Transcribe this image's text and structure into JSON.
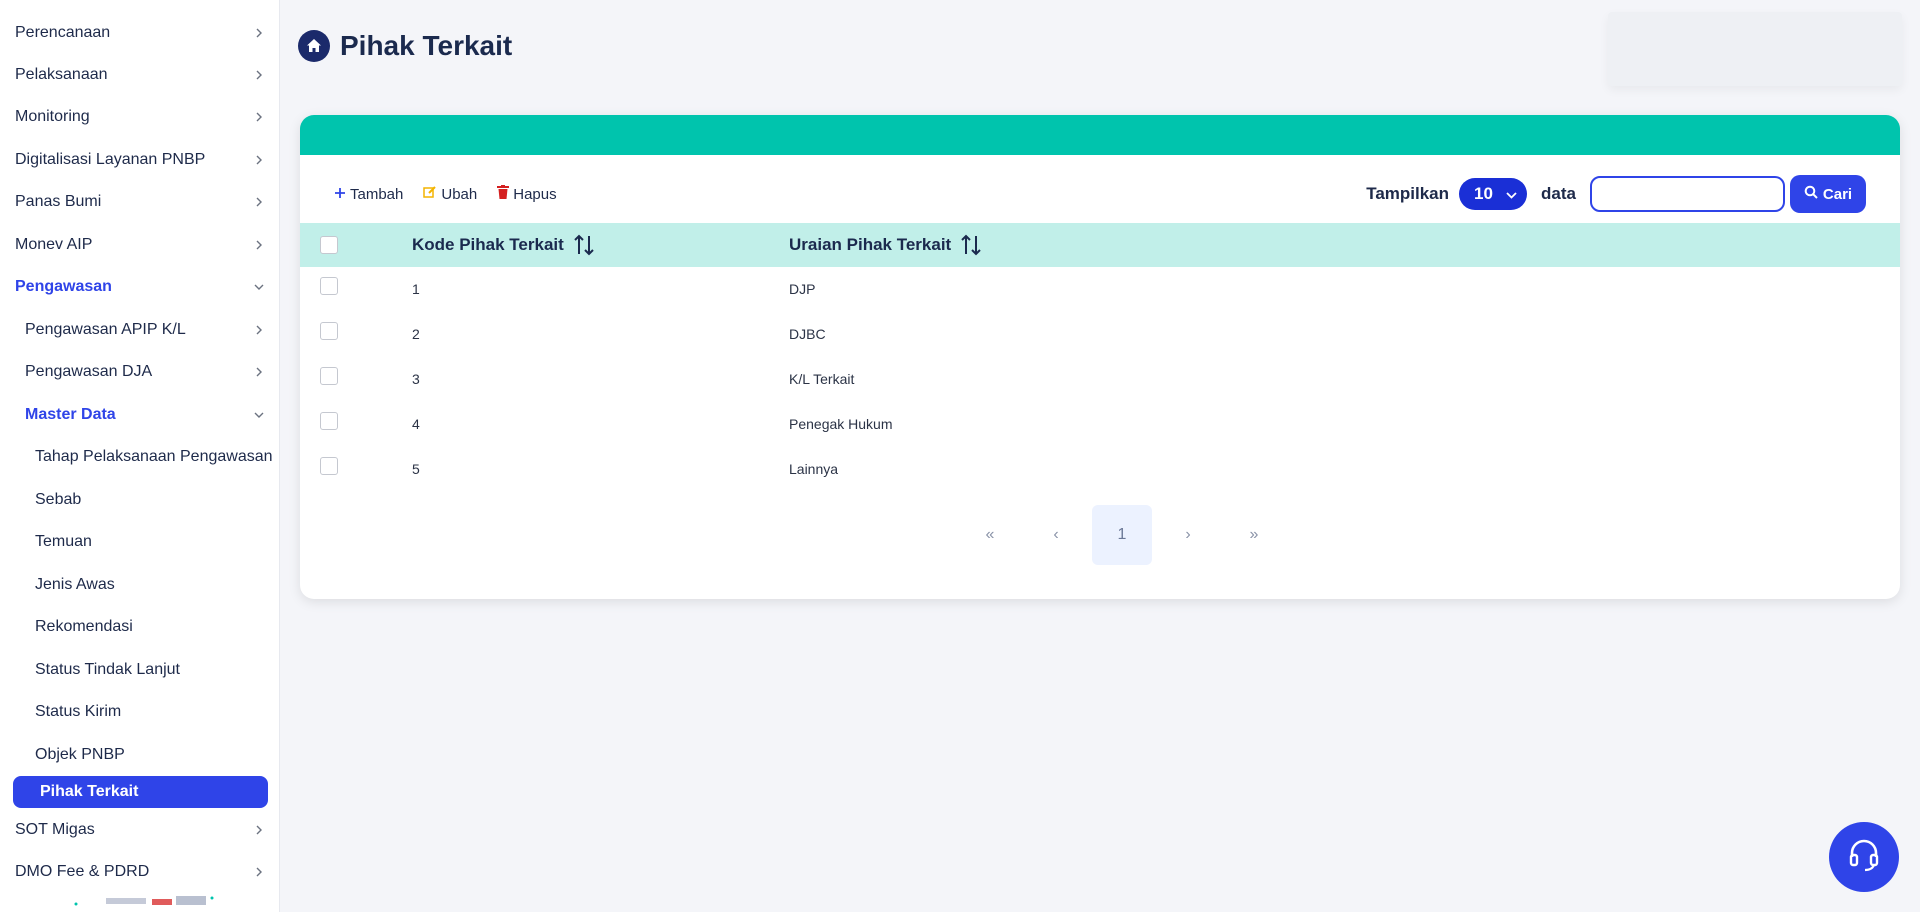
{
  "sidebar": {
    "items": [
      {
        "label": "Perencanaan",
        "chevron": "right"
      },
      {
        "label": "Pelaksanaan",
        "chevron": "right"
      },
      {
        "label": "Monitoring",
        "chevron": "right"
      },
      {
        "label": "Digitalisasi Layanan PNBP",
        "chevron": "right"
      },
      {
        "label": "Panas Bumi",
        "chevron": "right"
      },
      {
        "label": "Monev AIP",
        "chevron": "right"
      },
      {
        "label": "Pengawasan",
        "chevron": "down"
      },
      {
        "label": "Pengawasan APIP K/L",
        "chevron": "right"
      },
      {
        "label": "Pengawasan DJA",
        "chevron": "right"
      },
      {
        "label": "Master Data",
        "chevron": "down"
      },
      {
        "label": "Tahap Pelaksanaan Pengawasan"
      },
      {
        "label": "Sebab"
      },
      {
        "label": "Temuan"
      },
      {
        "label": "Jenis Awas"
      },
      {
        "label": "Rekomendasi"
      },
      {
        "label": "Status Tindak Lanjut"
      },
      {
        "label": "Status Kirim"
      },
      {
        "label": "Objek PNBP"
      },
      {
        "label": "Pihak Terkait"
      },
      {
        "label": "SOT Migas",
        "chevron": "right"
      },
      {
        "label": "DMO Fee & PDRD",
        "chevron": "right"
      }
    ]
  },
  "header": {
    "title": "Pihak Terkait",
    "icon": "home-icon"
  },
  "toolbar": {
    "add_label": "Tambah",
    "edit_label": "Ubah",
    "delete_label": "Hapus"
  },
  "filter": {
    "show_label": "Tampilkan",
    "page_size": "10",
    "data_label": "data",
    "search_value": "",
    "search_button": "Cari"
  },
  "table": {
    "columns": [
      "Kode Pihak Terkait",
      "Uraian Pihak Terkait"
    ],
    "rows": [
      {
        "kode": "1",
        "uraian": "DJP"
      },
      {
        "kode": "2",
        "uraian": "DJBC"
      },
      {
        "kode": "3",
        "uraian": "K/L Terkait"
      },
      {
        "kode": "4",
        "uraian": "Penegak Hukum"
      },
      {
        "kode": "5",
        "uraian": "Lainnya"
      }
    ]
  },
  "pagination": {
    "first": "«",
    "prev": "‹",
    "current_page": "1",
    "next": "›",
    "last": "»"
  },
  "colors": {
    "primary": "#2f44e8",
    "teal_band": "#00c4ad",
    "table_header": "#c1efe9",
    "navy": "#1b2a6b"
  }
}
